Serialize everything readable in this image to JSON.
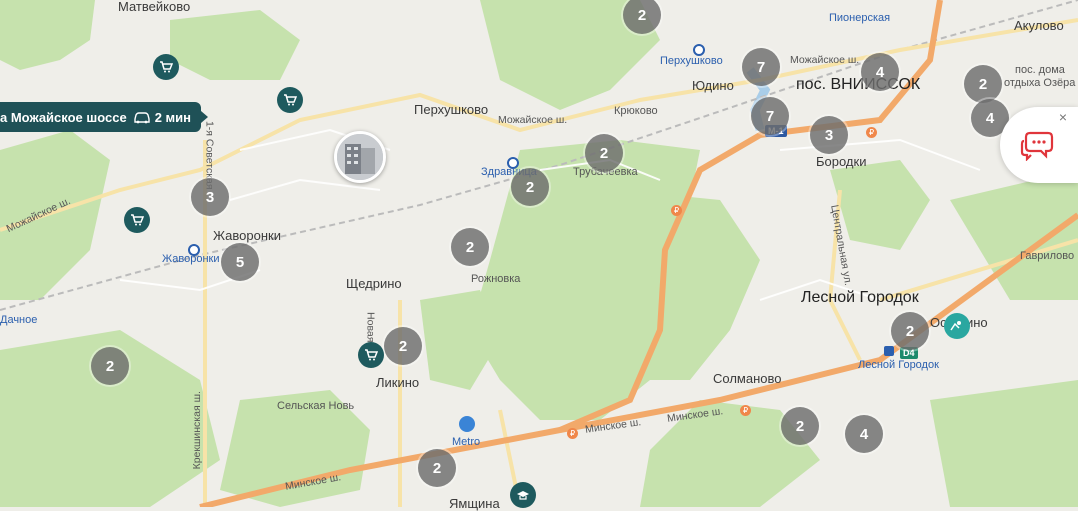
{
  "colors": {
    "background": "#efeee9",
    "forest": "#c6e2ad",
    "highway": "#f2a96a",
    "road": "#ffffff",
    "road_secondary": "#f7e3a8",
    "water": "#a9cde8",
    "cluster": "#6e6e6e",
    "shop_marker": "#1e5a5e",
    "tooltip": "#1f5157",
    "chat_icon": "#e0353b"
  },
  "route_tooltip": {
    "text": "а Можайское шоссе",
    "duration": "2 мин",
    "car_icon": "car-icon"
  },
  "clusters": [
    "2",
    "7",
    "4",
    "2",
    "7",
    "3",
    "4",
    "2",
    "2",
    "3",
    "2",
    "5",
    "2",
    "2",
    "2",
    "2",
    "4",
    "2"
  ],
  "place_labels": [
    "Матвейково",
    "Пионерская",
    "Акулово",
    "Перхушково",
    "Можайское ш.",
    "Юдино",
    "пос. ВНИИССОК",
    "пос. дома",
    "отдыха Озёра",
    "Перхушково",
    "Можайское ш.",
    "Крюково",
    "Трубачеевка",
    "Бородки",
    "Здравница",
    "Жаворонки",
    "Жаворонки",
    "Можайское ш.",
    "Рожновка",
    "Щедрино",
    "Лесной Городок",
    "Гаврилово",
    "Центральная ул.",
    "1-я Советская",
    "Новая",
    "Дачное",
    "Ликино",
    "Сельская Новь",
    "Крекшинская ш.",
    "Солманово",
    "Минское ш.",
    "Минское ш.",
    "Минское ш.",
    "Осоргино",
    "Лесной Городок",
    "Metro",
    "Ямщина"
  ],
  "road_badges": [
    "М-1",
    "D4"
  ],
  "icons": [
    "shop-cart-icon",
    "school-icon",
    "metro-store-icon",
    "train-station-icon",
    "chat-icon",
    "close-icon",
    "pool-icon"
  ],
  "chat_widget": {
    "close_symbol": "×"
  }
}
